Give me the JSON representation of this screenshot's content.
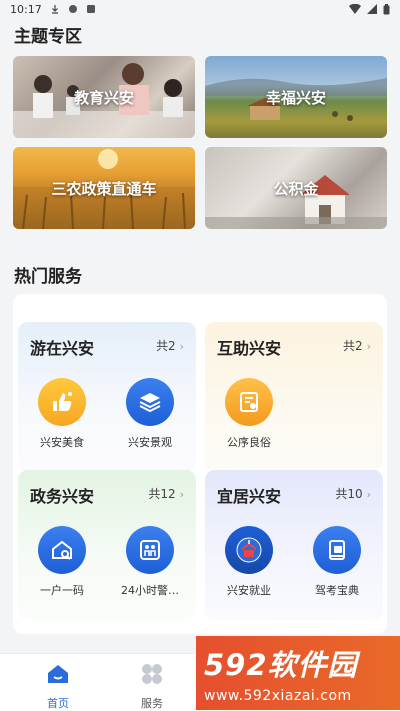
{
  "status_bar": {
    "time": "10:17"
  },
  "theme_section": {
    "title": "主题专区",
    "cards": [
      {
        "label": "教育兴安"
      },
      {
        "label": "幸福兴安"
      },
      {
        "label": "三农政策直通车"
      },
      {
        "label": "公积金"
      }
    ]
  },
  "hot_section": {
    "title": "热门服务",
    "groups": [
      {
        "title": "游在兴安",
        "count": "共2",
        "items": [
          {
            "label": "兴安美食",
            "icon": "thumbs-up-icon"
          },
          {
            "label": "兴安景观",
            "icon": "layers-icon"
          }
        ]
      },
      {
        "title": "互助兴安",
        "count": "共2",
        "items": [
          {
            "label": "公序良俗",
            "icon": "certificate-icon"
          }
        ]
      },
      {
        "title": "政务兴安",
        "count": "共12",
        "items": [
          {
            "label": "一户一码",
            "icon": "house-search-icon"
          },
          {
            "label": "24小时警…",
            "icon": "people-icon"
          }
        ]
      },
      {
        "title": "宜居兴安",
        "count": "共10",
        "items": [
          {
            "label": "兴安就业",
            "icon": "employment-icon"
          },
          {
            "label": "驾考宝典",
            "icon": "book-icon"
          }
        ]
      }
    ]
  },
  "tabbar": {
    "home": "首页",
    "service": "服务"
  },
  "watermark": {
    "brand": "592软件园",
    "url": "www.592xiazai.com"
  },
  "colors": {
    "accent": "#2a6cdb",
    "watermark": "#e64f2f"
  }
}
